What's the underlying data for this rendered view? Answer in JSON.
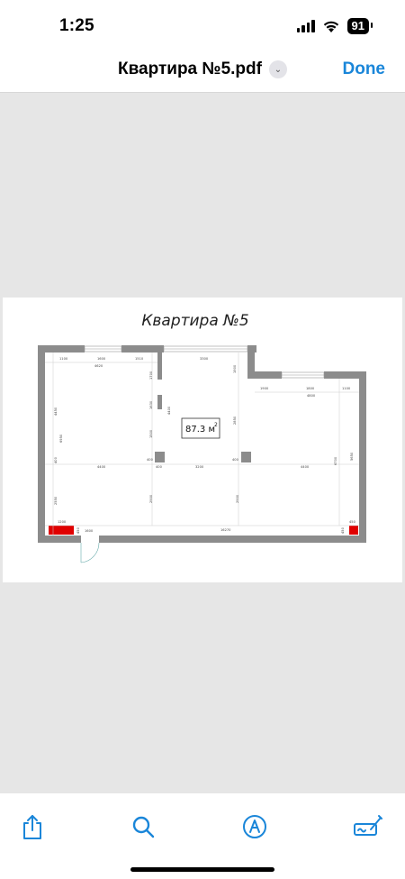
{
  "status_bar": {
    "time": "1:25",
    "battery": "91"
  },
  "nav": {
    "title": "Квартира №5.pdf",
    "done_label": "Done"
  },
  "document": {
    "title": "Квартира №5",
    "area": "87.3 м",
    "area_unit_sup": "2",
    "dimensions": {
      "top_left_a": "1100",
      "top_window": "1600",
      "top_left_b": "1510",
      "top_mid": "3300",
      "top_total": "4620",
      "right_a": "1900",
      "right_window": "1800",
      "right_b": "1100",
      "right_total": "4800",
      "left_v1": "4450",
      "left_v2": "6950",
      "left_v3": "2550",
      "col_v1": "1700",
      "col_v2": "1630",
      "col_v3": "1500",
      "col_v4": "4400",
      "col_v5": "2850",
      "right_v1": "5650",
      "right_v2": "6700",
      "mid_h1": "4400",
      "mid_h2": "3200",
      "mid_h3": "4400",
      "small_a": "400",
      "small_b": "400",
      "small_c": "400",
      "small_d": "400",
      "low_v1": "2900",
      "low_v2": "2900",
      "bottom_left": "1200",
      "bottom_door": "1600",
      "bottom_total": "16270",
      "bottom_right": "450",
      "left_low": "450",
      "right_low": "450"
    }
  },
  "toolbar": {
    "share": "share-icon",
    "search": "search-icon",
    "markup": "markup-icon",
    "sign": "signature-icon"
  },
  "colors": {
    "accent": "#1a86d9",
    "wall": "#8c8c8c",
    "radiator": "#e00000"
  }
}
